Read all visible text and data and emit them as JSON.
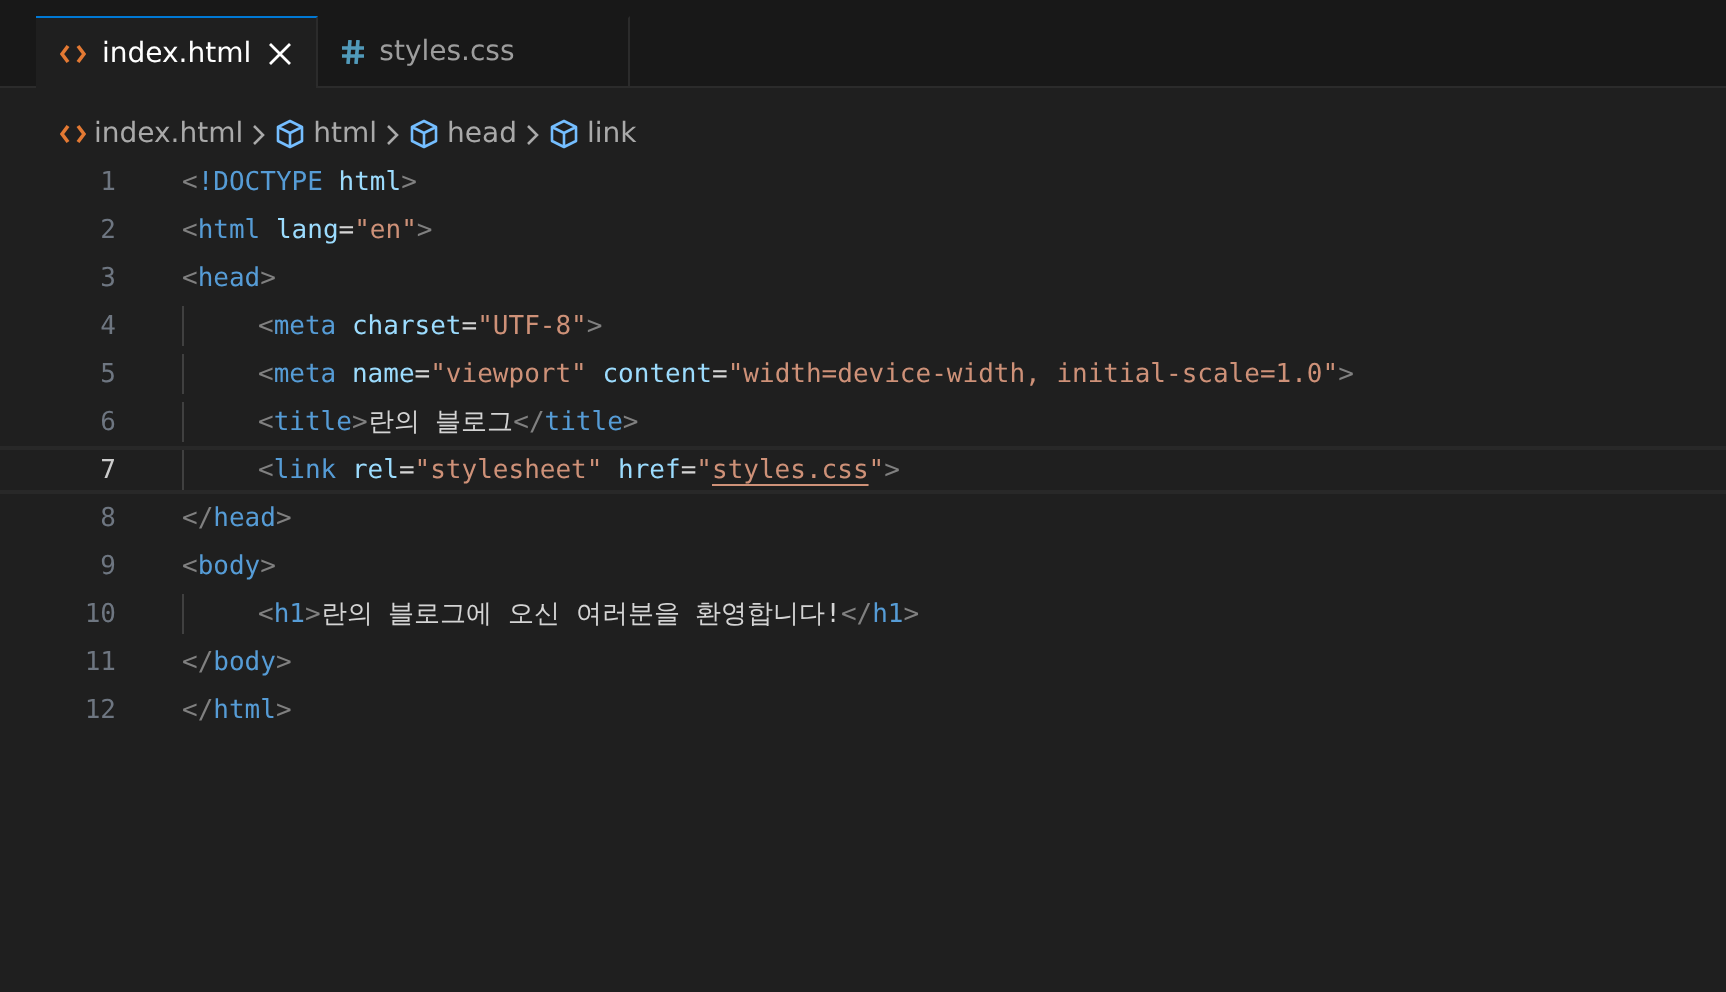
{
  "tabs": [
    {
      "label": "index.html",
      "kind": "html",
      "selected": true,
      "closable": true
    },
    {
      "label": "styles.css",
      "kind": "css",
      "selected": false,
      "closable": false
    }
  ],
  "breadcrumbs": [
    {
      "label": "index.html",
      "kind": "html"
    },
    {
      "label": "html",
      "kind": "element"
    },
    {
      "label": "head",
      "kind": "element"
    },
    {
      "label": "link",
      "kind": "element"
    }
  ],
  "lines": [
    {
      "number": "1",
      "indented": false,
      "current": false,
      "tokens": [
        {
          "kind": "punct",
          "text": "<"
        },
        {
          "kind": "tag",
          "text": "!DOCTYPE"
        },
        {
          "kind": "attr",
          "text": " html"
        },
        {
          "kind": "punct",
          "text": ">"
        }
      ]
    },
    {
      "number": "2",
      "indented": false,
      "current": false,
      "tokens": [
        {
          "kind": "punct",
          "text": "<"
        },
        {
          "kind": "tag",
          "text": "html"
        },
        {
          "kind": "attr",
          "text": " lang"
        },
        {
          "kind": "text",
          "text": "="
        },
        {
          "kind": "string",
          "text": "\"en\""
        },
        {
          "kind": "punct",
          "text": ">"
        }
      ]
    },
    {
      "number": "3",
      "indented": false,
      "current": false,
      "tokens": [
        {
          "kind": "punct",
          "text": "<"
        },
        {
          "kind": "tag",
          "text": "head"
        },
        {
          "kind": "punct",
          "text": ">"
        }
      ]
    },
    {
      "number": "4",
      "indented": true,
      "current": false,
      "tokens": [
        {
          "kind": "punct",
          "text": "<"
        },
        {
          "kind": "tag",
          "text": "meta"
        },
        {
          "kind": "attr",
          "text": " charset"
        },
        {
          "kind": "text",
          "text": "="
        },
        {
          "kind": "string",
          "text": "\"UTF-8\""
        },
        {
          "kind": "punct",
          "text": ">"
        }
      ]
    },
    {
      "number": "5",
      "indented": true,
      "current": false,
      "tokens": [
        {
          "kind": "punct",
          "text": "<"
        },
        {
          "kind": "tag",
          "text": "meta"
        },
        {
          "kind": "attr",
          "text": " name"
        },
        {
          "kind": "text",
          "text": "="
        },
        {
          "kind": "string",
          "text": "\"viewport\""
        },
        {
          "kind": "attr",
          "text": " content"
        },
        {
          "kind": "text",
          "text": "="
        },
        {
          "kind": "string",
          "text": "\"width=device-width, initial-scale=1.0\""
        },
        {
          "kind": "punct",
          "text": ">"
        }
      ]
    },
    {
      "number": "6",
      "indented": true,
      "current": false,
      "tokens": [
        {
          "kind": "punct",
          "text": "<"
        },
        {
          "kind": "tag",
          "text": "title"
        },
        {
          "kind": "punct",
          "text": ">"
        },
        {
          "kind": "text",
          "text": "란의 블로그"
        },
        {
          "kind": "punct",
          "text": "</"
        },
        {
          "kind": "tag",
          "text": "title"
        },
        {
          "kind": "punct",
          "text": ">"
        }
      ]
    },
    {
      "number": "7",
      "indented": true,
      "current": true,
      "tokens": [
        {
          "kind": "punct",
          "text": "<"
        },
        {
          "kind": "tag",
          "text": "link"
        },
        {
          "kind": "attr",
          "text": " rel"
        },
        {
          "kind": "text",
          "text": "="
        },
        {
          "kind": "string",
          "text": "\"stylesheet\""
        },
        {
          "kind": "attr",
          "text": " href"
        },
        {
          "kind": "text",
          "text": "="
        },
        {
          "kind": "string",
          "text": "\""
        },
        {
          "kind": "link",
          "text": "styles.css"
        },
        {
          "kind": "string",
          "text": "\""
        },
        {
          "kind": "punct",
          "text": ">"
        }
      ]
    },
    {
      "number": "8",
      "indented": false,
      "current": false,
      "tokens": [
        {
          "kind": "punct",
          "text": "</"
        },
        {
          "kind": "tag",
          "text": "head"
        },
        {
          "kind": "punct",
          "text": ">"
        }
      ]
    },
    {
      "number": "9",
      "indented": false,
      "current": false,
      "tokens": [
        {
          "kind": "punct",
          "text": "<"
        },
        {
          "kind": "tag",
          "text": "body"
        },
        {
          "kind": "punct",
          "text": ">"
        }
      ]
    },
    {
      "number": "10",
      "indented": true,
      "current": false,
      "tokens": [
        {
          "kind": "punct",
          "text": "<"
        },
        {
          "kind": "tag",
          "text": "h1"
        },
        {
          "kind": "punct",
          "text": ">"
        },
        {
          "kind": "text",
          "text": "란의 블로그에 오신 여러분을 환영합니다!"
        },
        {
          "kind": "punct",
          "text": "</"
        },
        {
          "kind": "tag",
          "text": "h1"
        },
        {
          "kind": "punct",
          "text": ">"
        }
      ]
    },
    {
      "number": "11",
      "indented": false,
      "current": false,
      "tokens": [
        {
          "kind": "punct",
          "text": "</"
        },
        {
          "kind": "tag",
          "text": "body"
        },
        {
          "kind": "punct",
          "text": ">"
        }
      ]
    },
    {
      "number": "12",
      "indented": false,
      "current": false,
      "tokens": [
        {
          "kind": "punct",
          "text": "</"
        },
        {
          "kind": "tag",
          "text": "html"
        },
        {
          "kind": "punct",
          "text": ">"
        }
      ]
    }
  ]
}
